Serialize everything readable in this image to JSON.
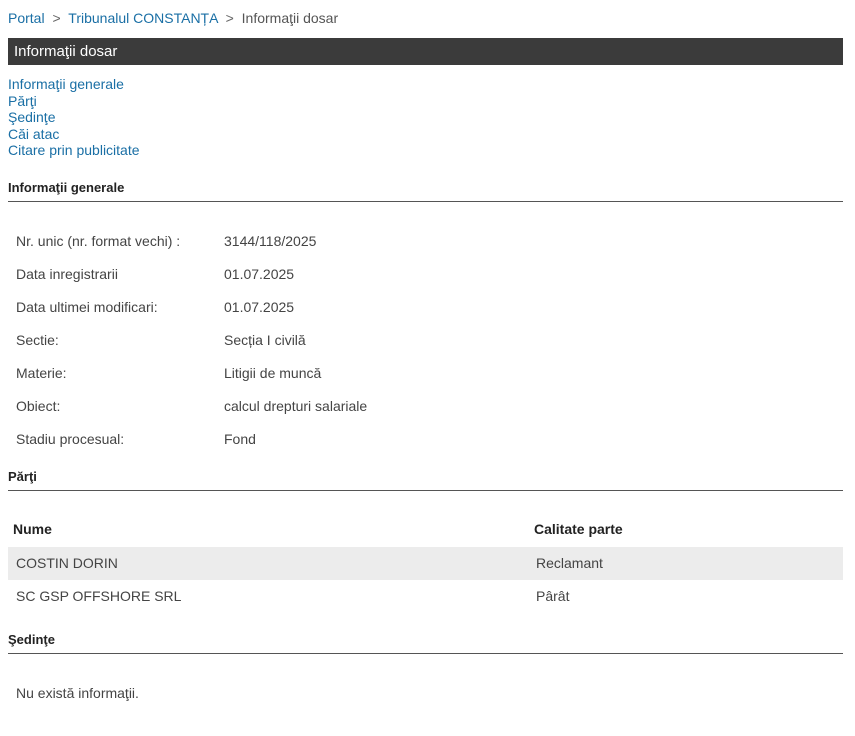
{
  "breadcrumb": {
    "portal": "Portal",
    "court": "Tribunalul CONSTANȚA",
    "current": "Informaţii dosar",
    "separator": ">"
  },
  "header": {
    "title": "Informaţii dosar"
  },
  "toc": {
    "items": [
      "Informaţii generale",
      "Părţi",
      "Şedinţe",
      "Căi atac",
      "Citare prin publicitate"
    ]
  },
  "general": {
    "title": "Informaţii generale",
    "rows": [
      {
        "label": "Nr. unic (nr. format vechi) :",
        "value": "3144/118/2025"
      },
      {
        "label": "Data inregistrarii",
        "value": "01.07.2025"
      },
      {
        "label": "Data ultimei modificari:",
        "value": "01.07.2025"
      },
      {
        "label": "Sectie:",
        "value": "Secția I civilă"
      },
      {
        "label": "Materie:",
        "value": "Litigii de muncă"
      },
      {
        "label": "Obiect:",
        "value": "calcul drepturi salariale"
      },
      {
        "label": "Stadiu procesual:",
        "value": "Fond"
      }
    ]
  },
  "parti": {
    "title": "Părţi",
    "columns": [
      "Nume",
      "Calitate parte"
    ],
    "rows": [
      {
        "nume": "COSTIN DORIN",
        "calitate": "Reclamant"
      },
      {
        "nume": "SC GSP OFFSHORE SRL",
        "calitate": "Pârât"
      }
    ]
  },
  "sedinte": {
    "title": "Şedinţe",
    "empty": "Nu există informaţii."
  },
  "colors": {
    "link": "#1a6fa5",
    "titlebar_bg": "#3b3b3b",
    "row_alt_bg": "#ececec"
  }
}
